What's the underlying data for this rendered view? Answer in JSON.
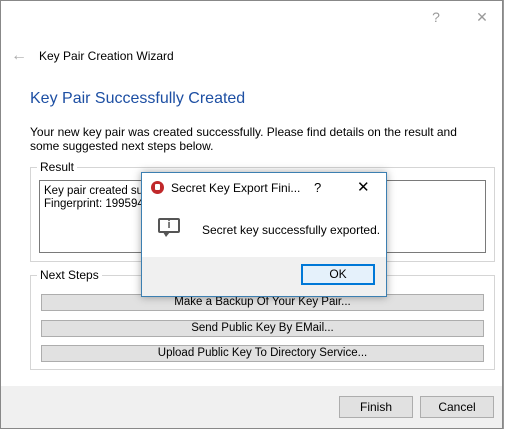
{
  "titlebar": {
    "help": "?",
    "close": "✕"
  },
  "wizard": {
    "back_glyph": "←",
    "title": "Key Pair Creation Wizard",
    "page_title": "Key Pair Successfully Created",
    "description": "Your new key pair was created successfully. Please find details on the result and some suggested next steps below."
  },
  "result": {
    "label": "Result",
    "line1": "Key pair created suc",
    "line2": "Fingerprint: 199594"
  },
  "next_steps": {
    "label": "Next Steps",
    "buttons": [
      "Make a Backup Of Your Key Pair...",
      "Send Public Key By EMail...",
      "Upload Public Key To Directory Service..."
    ]
  },
  "footer": {
    "finish": "Finish",
    "cancel": "Cancel"
  },
  "modal": {
    "title": "Secret Key Export Fini...",
    "help": "?",
    "close": "✕",
    "message": "Secret key successfully exported.",
    "ok": "OK"
  },
  "icons": {
    "app": "kleopatra-app-icon",
    "info": "message-info-icon",
    "back": "back-arrow-icon"
  },
  "colors": {
    "accent": "#0078d7",
    "title_blue": "#1d4fa3",
    "app_icon_red": "#c0282a"
  }
}
